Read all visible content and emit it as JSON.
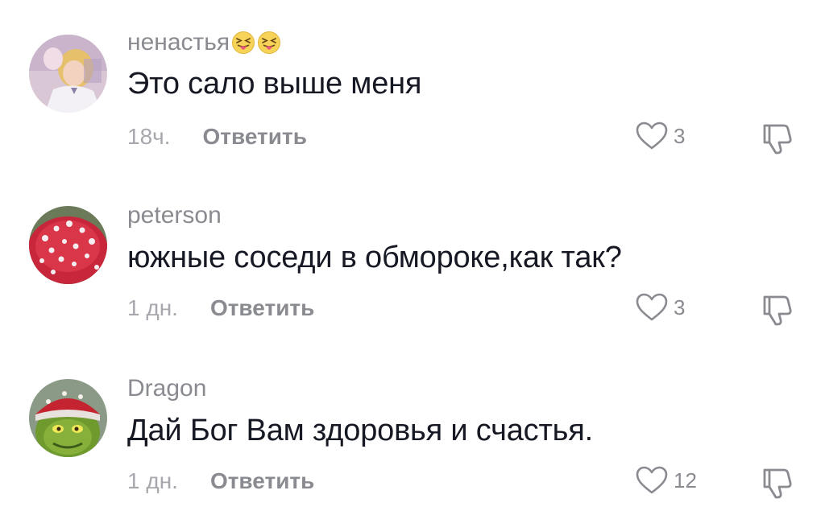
{
  "comments": [
    {
      "username": "ненастья",
      "emojis": [
        "squinting-face-with-tongue",
        "squinting-face-with-tongue"
      ],
      "text": "Это сало выше меня",
      "time": "18ч.",
      "reply_label": "Ответить",
      "likes": "3",
      "avatar": "cartoon-princess-avatar"
    },
    {
      "username": "peterson",
      "emojis": [],
      "text": "южные соседи в обмороке,как так?",
      "time": "1 дн.",
      "reply_label": "Ответить",
      "likes": "3",
      "avatar": "fly-agaric-mushroom-avatar"
    },
    {
      "username": "Dragon",
      "emojis": [],
      "text": "Дай Бог Вам здоровья и счастья.",
      "time": "1 дн.",
      "reply_label": "Ответить",
      "likes": "12",
      "avatar": "green-character-red-hat-avatar"
    }
  ],
  "colors": {
    "username": "#8a8b91",
    "text": "#161823",
    "time": "#a7a8ad",
    "icon_stroke": "#8a8b91"
  }
}
